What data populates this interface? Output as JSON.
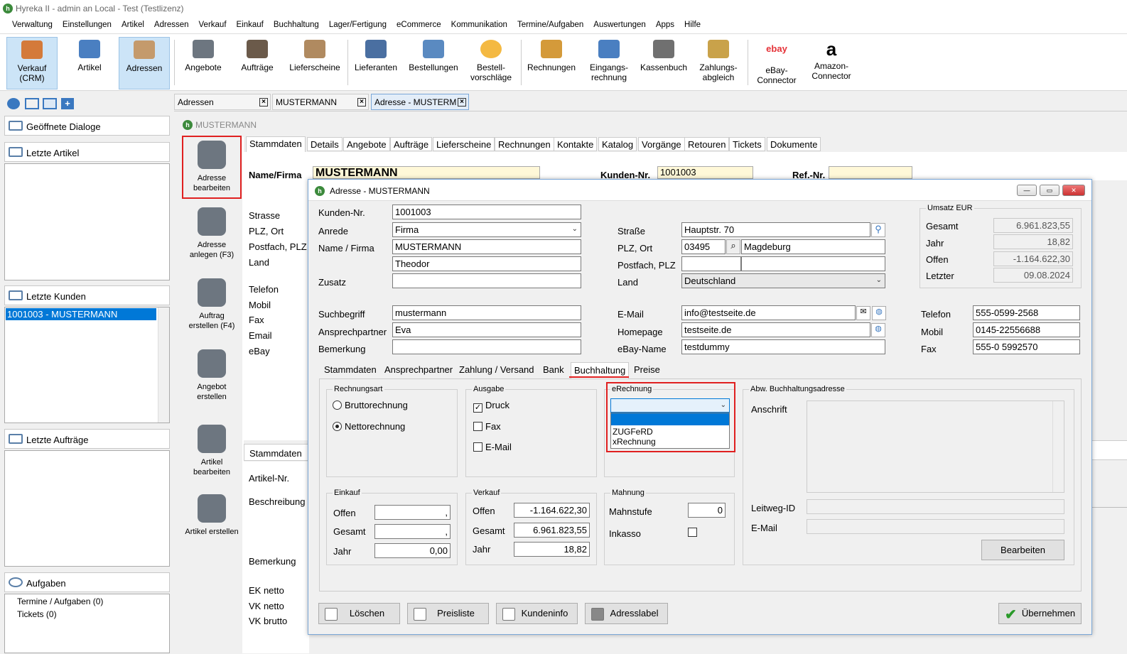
{
  "window": {
    "title": "Hyreka II - admin an Local - Test (Testlizenz)"
  },
  "menu": [
    "Verwaltung",
    "Einstellungen",
    "Artikel",
    "Adressen",
    "Verkauf",
    "Einkauf",
    "Buchhaltung",
    "Lager/Fertigung",
    "eCommerce",
    "Kommunikation",
    "Termine/Aufgaben",
    "Auswertungen",
    "Apps",
    "Hilfe"
  ],
  "ribbon": {
    "verkauf": "Verkauf (CRM)",
    "artikel": "Artikel",
    "adressen": "Adressen",
    "angebote": "Angebote",
    "auftraege": "Aufträge",
    "lieferscheine": "Lieferscheine",
    "lieferanten": "Lieferanten",
    "bestellungen": "Bestellungen",
    "bestellvorschlaege": "Bestell-\nvorschläge",
    "rechnungen": "Rechnungen",
    "eingangsrechnung": "Eingangs-\nrechnung",
    "kassenbuch": "Kassenbuch",
    "zahlungsabgleich": "Zahlungs-\nabgleich",
    "ebay_logo": "ebay",
    "ebay": "eBay-\nConnector",
    "amazon_logo": "a",
    "amazon": "Amazon-\nConnector"
  },
  "left": {
    "geoeffnete_dialoge": "Geöffnete Dialoge",
    "letzte_artikel": "Letzte Artikel",
    "letzte_kunden": "Letzte Kunden",
    "kunden_item": "1001003 - MUSTERMANN",
    "letzte_auftraege": "Letzte Aufträge",
    "aufgaben": "Aufgaben",
    "termine": "Termine / Aufgaben (0)",
    "tickets": "Tickets (0)"
  },
  "doctabs": [
    "Adressen",
    "MUSTERMANN",
    "Adresse - MUSTERM"
  ],
  "work": {
    "header": "MUSTERMANN",
    "side": {
      "adresse_bearbeiten": "Adresse bearbeiten",
      "adresse_anlegen": "Adresse anlegen (F3)",
      "auftrag_erstellen": "Auftrag erstellen (F4)",
      "angebot_erstellen": "Angebot erstellen",
      "artikel_bearbeiten": "Artikel bearbeiten",
      "artikel_erstellen": "Artikel erstellen"
    },
    "subtabs": [
      "Stammdaten",
      "Details",
      "Angebote",
      "Aufträge",
      "Lieferscheine",
      "Rechnungen",
      "Kontakte",
      "Katalog",
      "Vorgänge",
      "Retouren",
      "Tickets",
      "Dokumente"
    ],
    "name_firma": "Name/Firma",
    "name_value": "MUSTERMANN",
    "kunden_nr_lbl": "Kunden-Nr.",
    "kunden_nr_val": "1001003",
    "ref_nr_lbl": "Ref.-Nr.",
    "labels": [
      "Strasse",
      "PLZ, Ort",
      "Postfach, PLZ",
      "Land",
      "Telefon",
      "Mobil",
      "Fax",
      "Email",
      "eBay"
    ],
    "stammdaten2": "Stammdaten",
    "labels2": [
      "Artikel-Nr.",
      "Beschreibung",
      "Bemerkung",
      "EK netto",
      "VK netto",
      "VK brutto"
    ]
  },
  "dialog": {
    "title": "Adresse - MUSTERMANN",
    "kunden_nr_lbl": "Kunden-Nr.",
    "kunden_nr": "1001003",
    "anrede_lbl": "Anrede",
    "anrede": "Firma",
    "name_lbl": "Name / Firma",
    "name1": "MUSTERMANN",
    "name2": "Theodor",
    "zusatz_lbl": "Zusatz",
    "suchbegriff_lbl": "Suchbegriff",
    "suchbegriff": "mustermann",
    "ansprechpartner_lbl": "Ansprechpartner",
    "ansprechpartner": "Eva",
    "bemerkung_lbl": "Bemerkung",
    "strasse_lbl": "Straße",
    "strasse": "Hauptstr. 70",
    "plz_ort_lbl": "PLZ, Ort",
    "plz": "03495",
    "ort": "Magdeburg",
    "postfach_lbl": "Postfach, PLZ",
    "land_lbl": "Land",
    "land": "Deutschland",
    "email_lbl": "E-Mail",
    "email": "info@testseite.de",
    "homepage_lbl": "Homepage",
    "homepage": "testseite.de",
    "ebay_lbl": "eBay-Name",
    "ebay": "testdummy",
    "umsatz": {
      "title": "Umsatz EUR",
      "gesamt_lbl": "Gesamt",
      "gesamt": "6.961.823,55",
      "jahr_lbl": "Jahr",
      "jahr": "18,82",
      "offen_lbl": "Offen",
      "offen": "-1.164.622,30",
      "letzter_lbl": "Letzter",
      "letzter": "09.08.2024"
    },
    "telefon_lbl": "Telefon",
    "telefon": "555-0599-2568",
    "mobil_lbl": "Mobil",
    "mobil": "0145-22556688",
    "fax_lbl": "Fax",
    "fax": "555-0 5992570",
    "tabs": [
      "Stammdaten",
      "Ansprechpartner",
      "Zahlung / Versand",
      "Bank",
      "Buchhaltung",
      "Preise"
    ],
    "rechnungsart": {
      "title": "Rechnungsart",
      "brutto": "Bruttorechnung",
      "netto": "Nettorechnung"
    },
    "ausgabe": {
      "title": "Ausgabe",
      "druck": "Druck",
      "fax": "Fax",
      "email": "E-Mail"
    },
    "erechnung": {
      "title": "eRechnung",
      "options": [
        "ZUGFeRD",
        "xRechnung"
      ]
    },
    "abw": {
      "title": "Abw. Buchhaltungsadresse",
      "anschrift": "Anschrift",
      "leitweg": "Leitweg-ID",
      "email": "E-Mail",
      "bearbeiten": "Bearbeiten"
    },
    "einkauf": {
      "title": "Einkauf",
      "offen_lbl": "Offen",
      "offen": ",",
      "gesamt_lbl": "Gesamt",
      "gesamt": ",",
      "jahr_lbl": "Jahr",
      "jahr": "0,00"
    },
    "verkauf": {
      "title": "Verkauf",
      "offen_lbl": "Offen",
      "offen": "-1.164.622,30",
      "gesamt_lbl": "Gesamt",
      "gesamt": "6.961.823,55",
      "jahr_lbl": "Jahr",
      "jahr": "18,82"
    },
    "mahnung": {
      "title": "Mahnung",
      "mahnstufe_lbl": "Mahnstufe",
      "mahnstufe": "0",
      "inkasso_lbl": "Inkasso"
    },
    "buttons": {
      "loeschen": "Löschen",
      "preisliste": "Preisliste",
      "kundeninfo": "Kundeninfo",
      "adresslabel": "Adresslabel",
      "uebernehmen": "Übernehmen"
    }
  }
}
